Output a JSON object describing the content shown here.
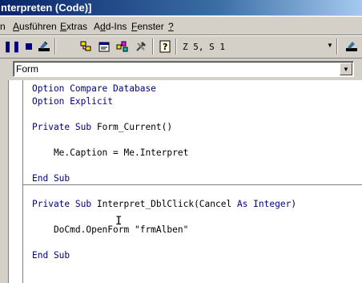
{
  "window": {
    "title": "nterpreten (Code)]"
  },
  "menu": {
    "items": [
      {
        "label": "n"
      },
      {
        "label": "Ausführen",
        "accel": "A"
      },
      {
        "label": "Extras",
        "accel": "E"
      },
      {
        "label": "Add-Ins",
        "accel": "d"
      },
      {
        "label": "Fenster",
        "accel": "F"
      },
      {
        "label": "?"
      }
    ]
  },
  "toolbar": {
    "position": "Z 5, S 1",
    "buttons": [
      "pause-icon",
      "stop-icon",
      "design-mode-icon",
      "project-explorer-icon",
      "properties-icon",
      "object-browser-icon",
      "toolbox-icon",
      "help-icon",
      "design-mode-icon"
    ]
  },
  "object_dropdown": {
    "value": "Form"
  },
  "code": {
    "lines": [
      {
        "kw": "Option Compare Database",
        "tx": ""
      },
      {
        "kw": "Option Explicit",
        "tx": ""
      },
      {
        "kw": "",
        "tx": ""
      },
      {
        "kw": "Private Sub ",
        "tx": "Form_Current()"
      },
      {
        "kw": "",
        "tx": ""
      },
      {
        "kw": "",
        "tx": "    Me.Caption = Me.Interpret"
      },
      {
        "kw": "",
        "tx": ""
      },
      {
        "kw": "End Sub",
        "tx": ""
      },
      {
        "kw": "",
        "tx": ""
      },
      {
        "kw": "Private Sub ",
        "tx": "Interpret_DblClick(Cancel ",
        "kw2": "As Integer",
        "tx2": ")"
      },
      {
        "kw": "",
        "tx": ""
      },
      {
        "kw": "",
        "tx": "    DoCmd.OpenForm \"frmAlben\""
      },
      {
        "kw": "",
        "tx": ""
      },
      {
        "kw": "End Sub",
        "tx": ""
      }
    ]
  },
  "colors": {
    "keyword": "#00007f",
    "text": "#000000",
    "titlebar": "#0a246a"
  }
}
